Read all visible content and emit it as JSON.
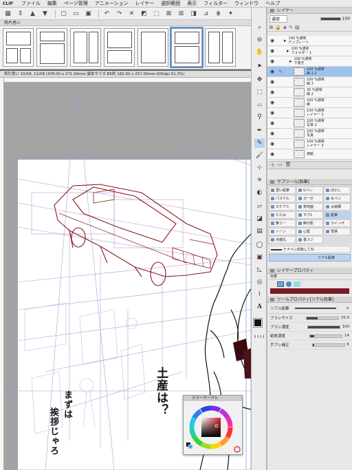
{
  "menubar": {
    "logo": "CLIP",
    "items": [
      "ファイル",
      "編集",
      "ページ管理",
      "アニメーション",
      "レイヤー",
      "選択範囲",
      "表示",
      "フィルター",
      "ウィンドウ",
      "ヘルプ"
    ]
  },
  "pages_panel": {
    "title": "両片思い"
  },
  "document_tab": {
    "title": "両片思い 10/58, 11/58 (378.00 x 271.00mm 製本サイズ:B5判 182.00 x 257.00mm 600dpi 51.3%)"
  },
  "canvas_text": {
    "line1": "土産は？",
    "line2": "まずは",
    "line3": "挨拶じゃろ"
  },
  "layer_panel": {
    "title": "レイヤー",
    "blend_mode": "通常",
    "opacity": "100",
    "layers": [
      {
        "opacity": "100 %通常",
        "name": "テンプレート",
        "type": "folder"
      },
      {
        "opacity": "100 %通常",
        "name": "フォルダー 1",
        "type": "folder"
      },
      {
        "opacity": "100 %通常",
        "name": "下書き",
        "type": "folder"
      },
      {
        "opacity": "100 %通常",
        "name": "線 2 2",
        "type": "raster",
        "selected": true
      },
      {
        "opacity": "100 %通常",
        "name": "線 2",
        "type": "raster"
      },
      {
        "opacity": "30 %通常",
        "name": "線 2",
        "type": "raster"
      },
      {
        "opacity": "100 %通常",
        "name": "線",
        "type": "raster"
      },
      {
        "opacity": "100 %通常",
        "name": "レイヤー 2",
        "type": "raster"
      },
      {
        "opacity": "100 %通常",
        "name": "写真 2",
        "type": "raster"
      },
      {
        "opacity": "100 %通常",
        "name": "写真",
        "type": "raster"
      },
      {
        "opacity": "100 %通常",
        "name": "レイヤー 3",
        "type": "raster"
      },
      {
        "opacity": "",
        "name": "用紙",
        "type": "paper"
      }
    ]
  },
  "subtool_panel": {
    "title": "サブツール[鉛筆]",
    "items": [
      "濃い鉛筆",
      "Gペン",
      "ぼかし",
      "パステル",
      "ガーゼ",
      "水ペン",
      "カケアミ",
      "荒地面",
      "太線橋",
      "たたみ",
      "モブ1",
      "鉛筆",
      "舞うー",
      "鮮の影",
      "ラインザ",
      "トーン",
      "心配",
      "雪柄",
      "点描丸",
      "書スジ"
    ],
    "selected_index": 11,
    "preview_1": "ナナペン反転してね",
    "preview_2": "リアル鉛筆"
  },
  "layer_property": {
    "title": "レイヤープロパティ",
    "effect_label": "効果"
  },
  "tool_property": {
    "title": "ツールプロパティ[リアル鉛筆]",
    "brush_name": "リアル鉛筆",
    "rows": [
      {
        "label": "ブラシサイズ",
        "value": "25.0",
        "fill": 0.35
      },
      {
        "label": "ブラシ濃度",
        "value": "100",
        "fill": 1.0
      },
      {
        "label": "紙質濃度",
        "value": "14",
        "fill": 0.14
      },
      {
        "label": "手ブレ補正",
        "value": "6",
        "fill": 0.06
      }
    ]
  },
  "color_circle": {
    "title": "カラーサークル",
    "main_color": "#111111",
    "picked_color": "#8a1d26"
  },
  "colors": {
    "accent": "#5a8fd8",
    "selected_layer": "#9ec3ec",
    "drawing_red": "#8a1522",
    "guide_purple": "#b79ad6"
  }
}
